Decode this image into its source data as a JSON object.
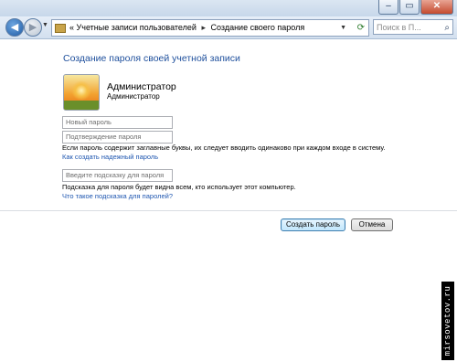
{
  "breadcrumb": {
    "items": [
      "Учетные записи пользователей",
      "Создание своего пароля"
    ],
    "prefix": "«"
  },
  "search": {
    "placeholder": "Поиск в П..."
  },
  "page": {
    "title": "Создание пароля своей учетной записи"
  },
  "user": {
    "name": "Администратор",
    "role": "Администратор"
  },
  "form": {
    "new_password_placeholder": "Новый пароль",
    "confirm_password_placeholder": "Подтверждение пароля",
    "case_note": "Если пароль содержит заглавные буквы, их следует вводить одинаково при каждом входе в систему.",
    "strong_password_link": "Как создать надежный пароль",
    "hint_placeholder": "Введите подсказку для пароля",
    "hint_note": "Подсказка для пароля будет видна всем, кто использует этот компьютер.",
    "hint_link": "Что такое подсказка для паролей?"
  },
  "buttons": {
    "create": "Создать пароль",
    "cancel": "Отмена"
  },
  "watermark": "mirsovetov.ru",
  "colors": {
    "link": "#1e56b0",
    "heading": "#1e4f9c"
  },
  "icons": [
    "back-arrow-icon",
    "forward-arrow-icon",
    "folder-icon",
    "refresh-icon",
    "search-icon",
    "user-avatar-flower"
  ]
}
